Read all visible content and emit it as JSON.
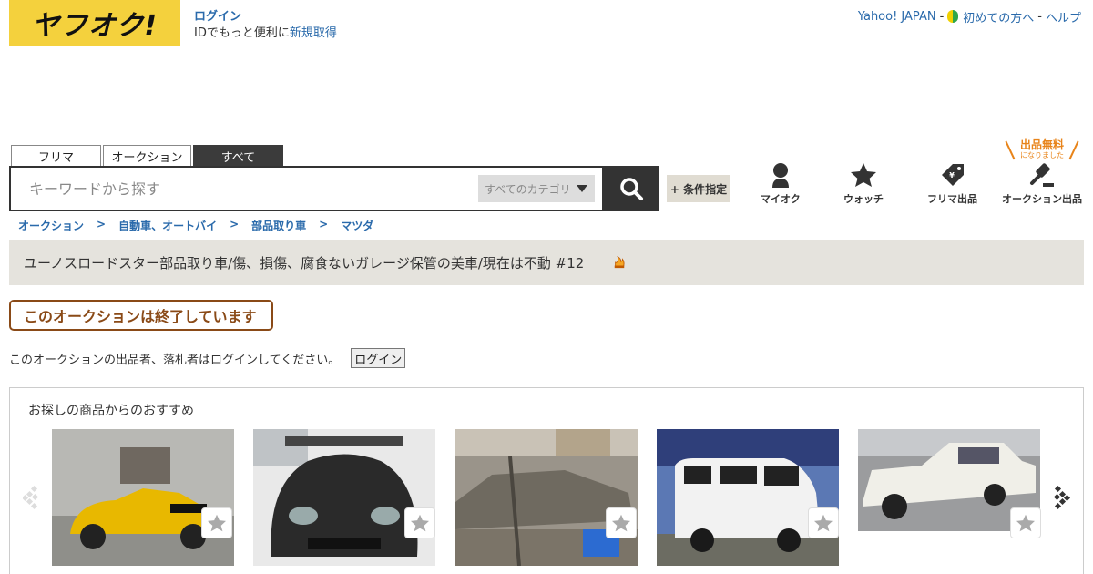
{
  "logo": {
    "text": "ヤフオク!"
  },
  "account": {
    "login_label": "ログイン",
    "sub_prefix": "IDでもっと便利に",
    "signup_label": "新規取得"
  },
  "top_links": {
    "yahoo": "Yahoo! JAPAN",
    "sep": "-",
    "beginner": "初めての方へ",
    "help": "ヘルプ"
  },
  "tabs": [
    {
      "label": "フリマ"
    },
    {
      "label": "オークション"
    },
    {
      "label": "すべて"
    }
  ],
  "search": {
    "placeholder": "キーワードから探す",
    "category": "すべてのカテゴリ"
  },
  "cond_button": "+ 条件指定",
  "nav": {
    "myauc": "マイオク",
    "watch": "ウォッチ",
    "flea_sell": "フリマ出品",
    "auction_sell": "オークション出品",
    "free_big": "出品無料",
    "free_small": "になりました"
  },
  "breadcrumb": [
    {
      "label": "オークション"
    },
    {
      "label": "自動車、オートバイ"
    },
    {
      "label": "部品取り車"
    },
    {
      "label": "マツダ"
    }
  ],
  "breadcrumb_sep": ">",
  "item_title": "ユーノスロードスター部品取り車/傷、損傷、腐食ないガレージ保管の美車/現在は不動 #12",
  "status": {
    "ended": "このオークションは終了しています"
  },
  "login_notice": {
    "text": "このオークションの出品者、落札者はログインしてください。",
    "button": "ログイン"
  },
  "recommend": {
    "title": "お探しの商品からのおすすめ",
    "items": [
      {
        "icon": "yellow-roadster-photo"
      },
      {
        "icon": "black-supra-photo"
      },
      {
        "icon": "silver-coupe-photo"
      },
      {
        "icon": "white-van-photo"
      },
      {
        "icon": "white-sedan-photo"
      }
    ]
  },
  "colors": {
    "logo_bg": "#f4d13d",
    "link": "#2a6aab",
    "ended": "#8a4a17",
    "free": "#e8841a"
  }
}
